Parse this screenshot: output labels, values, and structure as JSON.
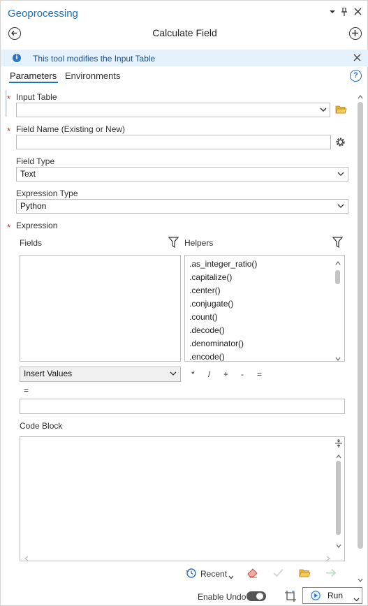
{
  "pane": {
    "title": "Geoprocessing",
    "tool_title": "Calculate Field",
    "controls": {
      "menu_icon": "chevron-down-icon",
      "pin_icon": "pin-icon",
      "close_icon": "close-icon"
    }
  },
  "info_bar": {
    "text": "This tool modifies the Input Table"
  },
  "tabs": [
    {
      "label": "Parameters",
      "active": true
    },
    {
      "label": "Environments",
      "active": false
    }
  ],
  "parameters": {
    "input_table": {
      "label": "Input Table",
      "required": true,
      "value": ""
    },
    "field_name": {
      "label": "Field Name (Existing or New)",
      "required": true,
      "value": ""
    },
    "field_type": {
      "label": "Field Type",
      "value": "Text"
    },
    "expression_type": {
      "label": "Expression Type",
      "value": "Python"
    },
    "expression": {
      "label": "Expression",
      "required": true,
      "fields_label": "Fields",
      "helpers_label": "Helpers",
      "helpers": [
        ".as_integer_ratio()",
        ".capitalize()",
        ".center()",
        ".conjugate()",
        ".count()",
        ".decode()",
        ".denominator()",
        ".encode()"
      ],
      "insert_values": "Insert Values",
      "operators": [
        "*",
        "/",
        "+",
        "-",
        "="
      ],
      "equals_label": "=",
      "expression_value": ""
    },
    "code_block": {
      "label": "Code Block",
      "value": ""
    }
  },
  "bottom_toolbar": {
    "recent_label": "Recent"
  },
  "footer": {
    "enable_undo_label": "Enable Undo",
    "enable_undo_on": false,
    "run_label": "Run"
  },
  "colors": {
    "accent": "#1a73b8",
    "required": "#c0392b",
    "info_bg": "#e5f1fb"
  }
}
